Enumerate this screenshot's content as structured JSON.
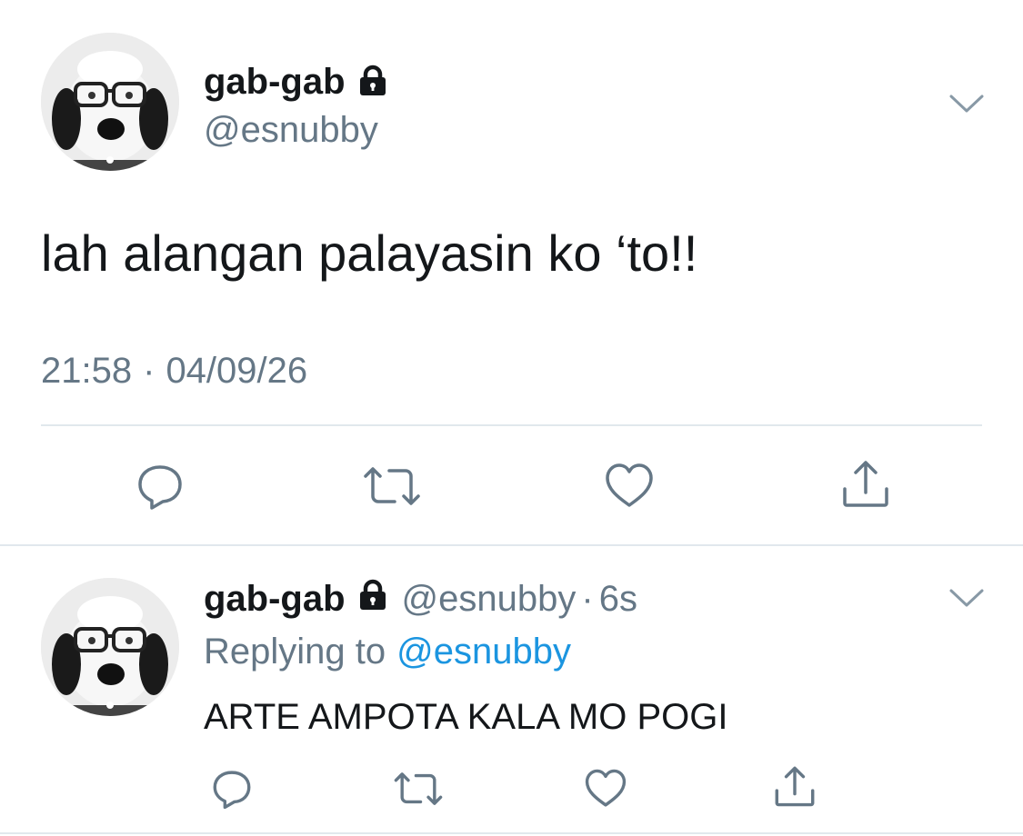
{
  "main_tweet": {
    "display_name": "gab-gab",
    "handle": "@esnubby",
    "text": "lah alangan palayasin ko ‘to!!",
    "time": "21:58",
    "separator": "·",
    "date": "04/09/26",
    "icons": {
      "protected": "lock-icon",
      "more": "chevron-down-icon",
      "reply": "reply-icon",
      "retweet": "retweet-icon",
      "like": "heart-icon",
      "share": "share-icon"
    }
  },
  "reply_tweet": {
    "display_name": "gab-gab",
    "handle": "@esnubby",
    "separator": "·",
    "age": "6s",
    "replying_prefix": "Replying to",
    "replying_handle": "@esnubby",
    "text": "ARTE AMPOTA KALA MO POGI"
  },
  "colors": {
    "text": "#14171a",
    "secondary": "#657786",
    "link": "#1b95e0",
    "divider": "#e1e8ed"
  }
}
